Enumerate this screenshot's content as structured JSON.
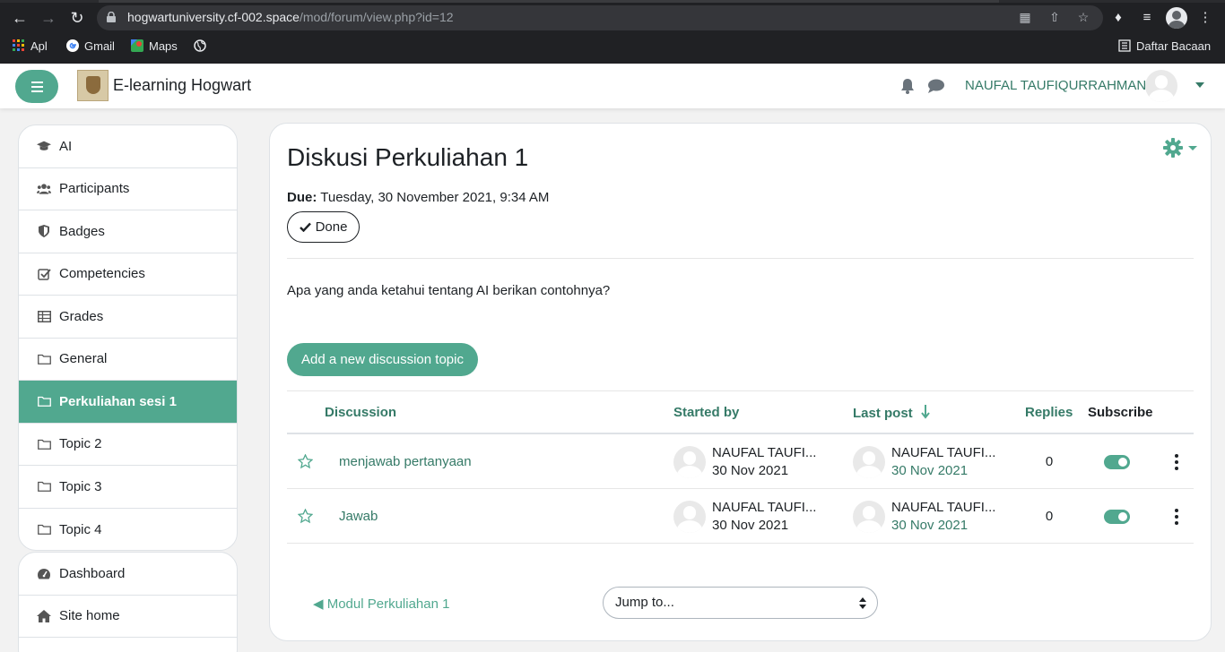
{
  "browser": {
    "url_host": "hogwartuniversity.cf-002.space",
    "url_path": "/mod/forum/view.php?id=12",
    "bookmarks": [
      "Apl",
      "Gmail",
      "Maps"
    ],
    "reading_list": "Daftar Bacaan"
  },
  "header": {
    "site_title": "E-learning Hogwart",
    "user_name": "NAUFAL TAUFIQURRAHMAN"
  },
  "sidebar": {
    "items": [
      {
        "label": "AI",
        "icon": "graduation-cap-icon"
      },
      {
        "label": "Participants",
        "icon": "users-icon"
      },
      {
        "label": "Badges",
        "icon": "shield-icon"
      },
      {
        "label": "Competencies",
        "icon": "check-square-icon"
      },
      {
        "label": "Grades",
        "icon": "table-icon"
      },
      {
        "label": "General",
        "icon": "folder-icon"
      },
      {
        "label": "Perkuliahan sesi 1",
        "icon": "folder-icon",
        "active": true
      },
      {
        "label": "Topic 2",
        "icon": "folder-icon"
      },
      {
        "label": "Topic 3",
        "icon": "folder-icon"
      },
      {
        "label": "Topic 4",
        "icon": "folder-icon"
      }
    ],
    "items2": [
      {
        "label": "Dashboard",
        "icon": "dashboard-icon"
      },
      {
        "label": "Site home",
        "icon": "home-icon"
      }
    ]
  },
  "main": {
    "title": "Diskusi Perkuliahan 1",
    "due_label": "Due:",
    "due_value": "Tuesday, 30 November 2021, 9:34 AM",
    "done_label": "Done",
    "intro": "Apa yang anda ketahui tentang AI berikan contohnya?",
    "add_topic_label": "Add a new discussion topic"
  },
  "table": {
    "headers": {
      "discussion": "Discussion",
      "started_by": "Started by",
      "last_post": "Last post",
      "replies": "Replies",
      "subscribe": "Subscribe"
    },
    "rows": [
      {
        "topic": "menjawab pertanyaan",
        "started_name": "NAUFAL TAUFI...",
        "started_date": "30 Nov 2021",
        "last_name": "NAUFAL TAUFI...",
        "last_date": "30 Nov 2021",
        "replies": "0",
        "subscribed": true
      },
      {
        "topic": "Jawab",
        "started_name": "NAUFAL TAUFI...",
        "started_date": "30 Nov 2021",
        "last_name": "NAUFAL TAUFI...",
        "last_date": "30 Nov 2021",
        "replies": "0",
        "subscribed": true
      }
    ]
  },
  "footer_nav": {
    "prev_link": "◀ Modul Perkuliahan 1",
    "jump_placeholder": "Jump to..."
  },
  "colors": {
    "accent": "#51a88f",
    "link": "#357a67"
  }
}
